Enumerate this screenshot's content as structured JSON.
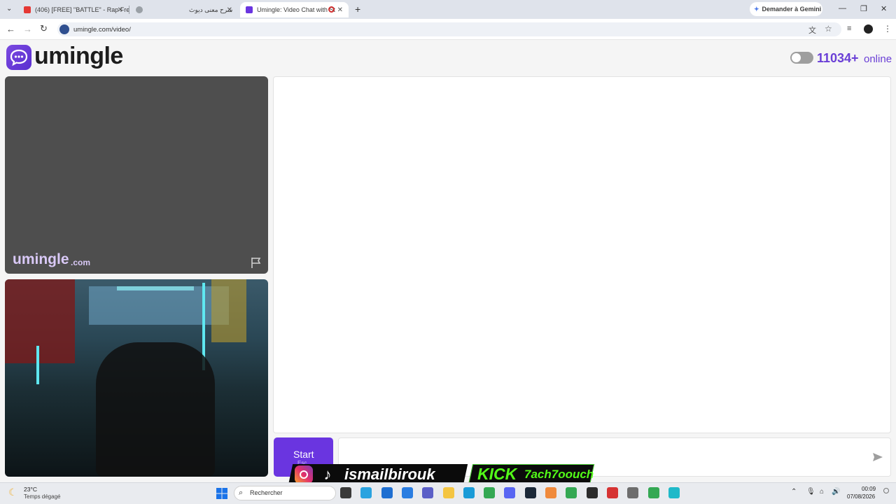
{
  "browser": {
    "tabs": [
      {
        "title": "(406) [FREE] \"BATTLE\" - Rap Fre",
        "color": "#e53935"
      },
      {
        "title": "شرح معنى ديوث",
        "color": "#9aa0a6"
      },
      {
        "title": "Umingle: Video Chat with St",
        "color": "#6a35e0"
      }
    ],
    "new_tab": "+",
    "gemini_label": "Demander à Gemini",
    "url": "umingle.com/video/"
  },
  "page": {
    "logo_text": "umingle",
    "online_count": "11034+",
    "online_label": "online",
    "watermark": "umingle",
    "watermark_suffix": ".com",
    "start_label": "Start",
    "esc_label": "Esc",
    "message_placeholder": ""
  },
  "overlay": {
    "instagram_user": "ismailbirouk",
    "kick_label": "KICK",
    "kick_user": "7ach7oouch"
  },
  "taskbar": {
    "weather_temp": "23°C",
    "weather_desc": "Temps dégagé",
    "search_label": "Rechercher",
    "time": "00:09",
    "date": "07/08/2026",
    "apps": [
      {
        "name": "file-manager",
        "color": "#3a3a3a"
      },
      {
        "name": "telegram",
        "color": "#2aa3e0"
      },
      {
        "name": "store",
        "color": "#1f6fd1"
      },
      {
        "name": "mail",
        "color": "#2a7de1"
      },
      {
        "name": "teams",
        "color": "#5b5fc7"
      },
      {
        "name": "explorer",
        "color": "#f4c542"
      },
      {
        "name": "edge",
        "color": "#1a9bd7"
      },
      {
        "name": "chrome",
        "color": "#34a853"
      },
      {
        "name": "discord",
        "color": "#5865f2"
      },
      {
        "name": "steam",
        "color": "#1b2838"
      },
      {
        "name": "app-orange",
        "color": "#f08a3c"
      },
      {
        "name": "chrome-2",
        "color": "#34a853"
      },
      {
        "name": "terminal",
        "color": "#2b2b2b"
      },
      {
        "name": "app-red",
        "color": "#d63333"
      },
      {
        "name": "settings",
        "color": "#6d6d6d"
      },
      {
        "name": "chrome-active",
        "color": "#34a853"
      },
      {
        "name": "app-teal",
        "color": "#1fb9c9"
      }
    ]
  }
}
